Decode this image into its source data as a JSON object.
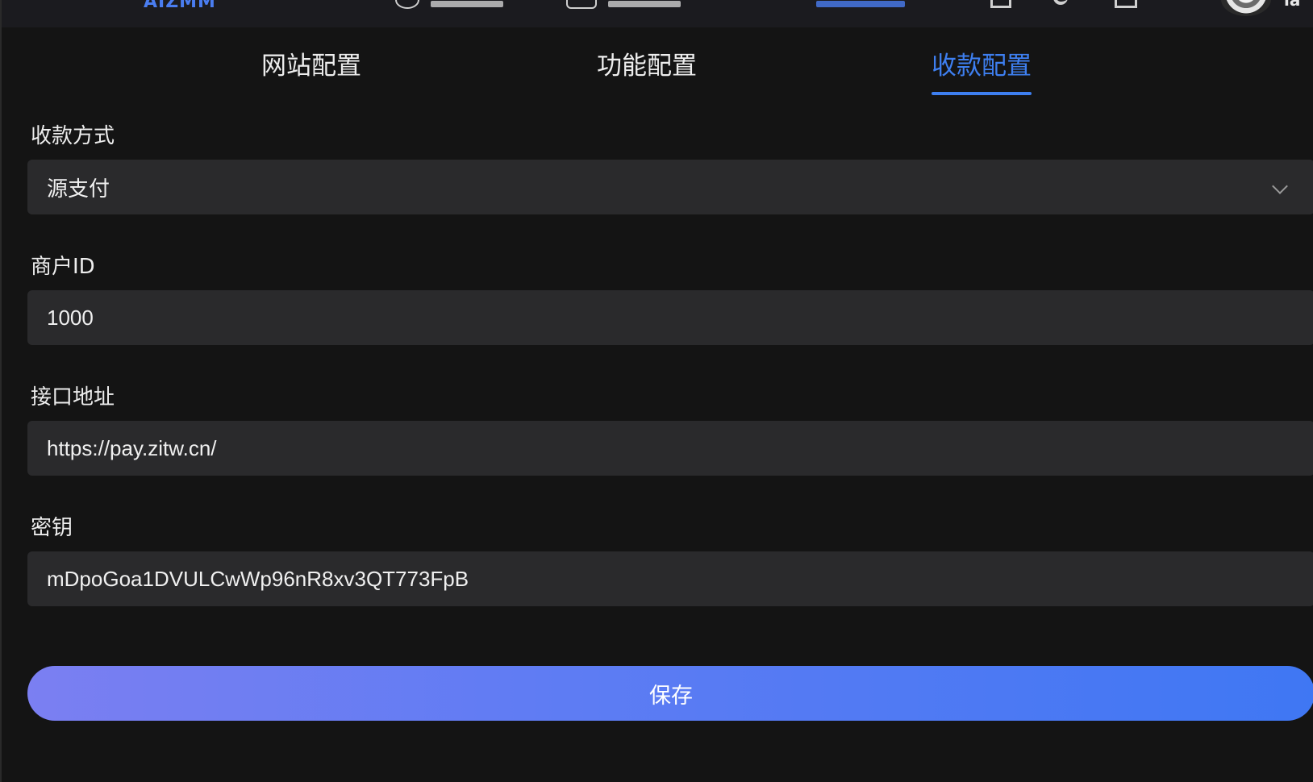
{
  "topbar": {
    "brand": "AIZMM",
    "user_name": "la"
  },
  "tabs": [
    {
      "label": "网站配置",
      "active": false
    },
    {
      "label": "功能配置",
      "active": false
    },
    {
      "label": "收款配置",
      "active": true
    }
  ],
  "form": {
    "payment_method": {
      "label": "收款方式",
      "value": "源支付"
    },
    "merchant_id": {
      "label": "商户ID",
      "value": "1000"
    },
    "api_url": {
      "label": "接口地址",
      "value": "https://pay.zitw.cn/"
    },
    "secret_key": {
      "label": "密钥",
      "value": "mDpoGoa1DVULCwWp96nR8xv3QT773FpB"
    },
    "save_label": "保存"
  },
  "colors": {
    "accent": "#3e7ff0",
    "background": "#141414",
    "field_bg": "#2a2a2c",
    "button_gradient_start": "#7b7ff2",
    "button_gradient_end": "#3f77f3"
  }
}
